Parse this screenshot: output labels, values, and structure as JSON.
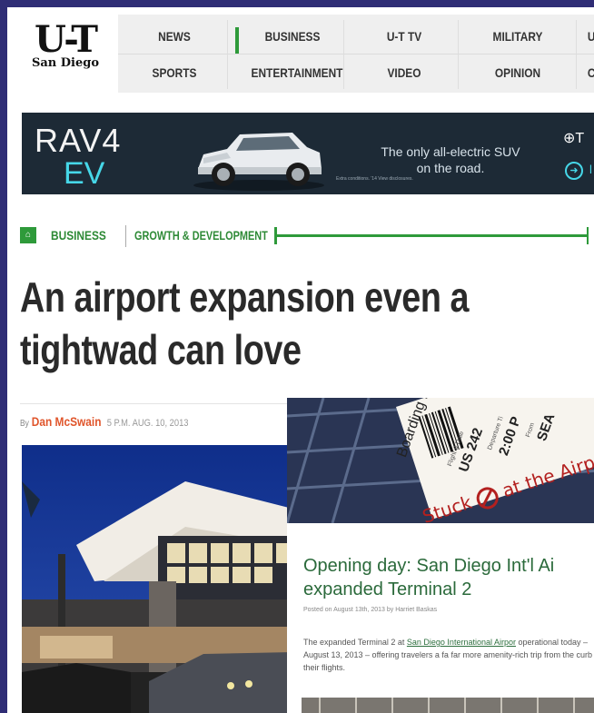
{
  "brand": {
    "logo_main": "U-T",
    "logo_sub": "San Diego"
  },
  "nav": {
    "row1": [
      "NEWS",
      "BUSINESS",
      "U-T TV",
      "MILITARY",
      "U"
    ],
    "row2": [
      "SPORTS",
      "ENTERTAINMENT",
      "VIDEO",
      "OPINION",
      "C"
    ],
    "active": "BUSINESS",
    "accent_color": "#2e9a3a"
  },
  "ad": {
    "model_top": "RAV4",
    "model_bottom": "EV",
    "tagline": "The only all-electric SUV on the road.",
    "disclaimer": "Extra conditions. '14 View disclosures.",
    "side_text": "T",
    "cta_text": "l",
    "colors": {
      "background": "#1d2a36",
      "accent": "#46d7e8"
    }
  },
  "breadcrumb": {
    "items": [
      "BUSINESS",
      "GROWTH & DEVELOPMENT"
    ],
    "color": "#2e8a36"
  },
  "article": {
    "headline": "An airport expansion even a tightwad can love",
    "byline_prefix": "By",
    "author": "Dan McSwain",
    "timestamp": "5 P.M.  AUG. 10, 2013",
    "author_color": "#e0552b"
  },
  "inset": {
    "boarding_pass": "Boarding P",
    "flight_label": "Flight & Date",
    "flight": "US 242",
    "departure_label": "Departure Ti",
    "time": "2:00 P",
    "from_label": "From",
    "from": "SEA",
    "stamp": "Stuck",
    "stamp_rest": "at the Airpo",
    "title": "Opening day: San Diego Int'l Ai expanded Terminal 2",
    "posted": "Posted on August 13th, 2013 by Harriet Baskas",
    "body_pre": "The expanded Terminal 2 at ",
    "body_link": "San Diego International Airpor",
    "body_post": " operational today – August 13, 2013 – offering travelers a fa far more amenity-rich trip from the curb to their flights.",
    "title_color": "#2b6a3b"
  }
}
